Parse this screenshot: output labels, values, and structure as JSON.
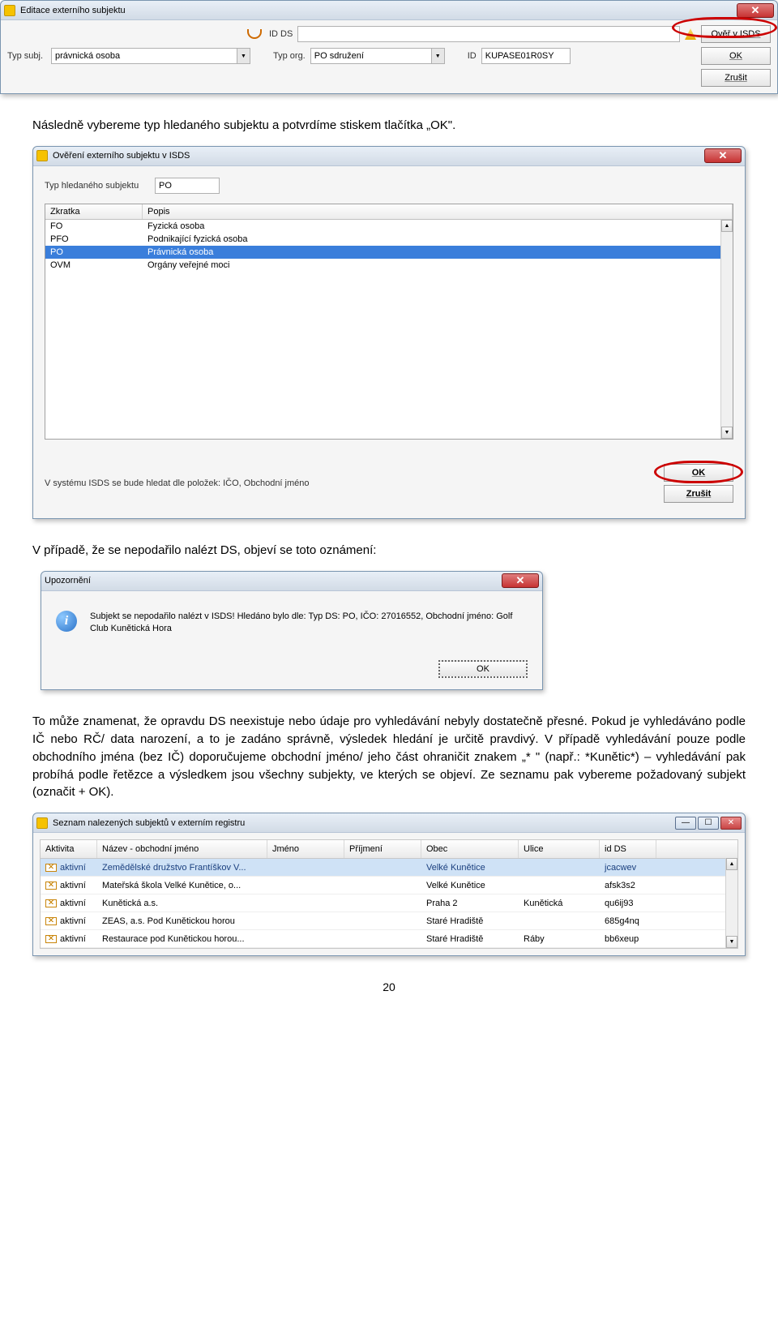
{
  "top_dialog": {
    "title": "Editace externího subjektu",
    "id_ds_label": "ID DS",
    "over_btn": "Ověř v ISDS",
    "typ_subj_label": "Typ subj.",
    "typ_subj_val": "právnická osoba",
    "typ_org_label": "Typ org.",
    "typ_org_val": "PO sdružení",
    "id_label": "ID",
    "id_val": "KUPASE01R0SY",
    "ok_btn": "OK",
    "cancel_btn": "Zrušit"
  },
  "para1": "Následně vybereme typ hledaného subjektu a potvrdíme stiskem tlačítka „OK\".",
  "verify_dialog": {
    "title": "Ověření externího subjektu v ISDS",
    "typ_label": "Typ hledaného subjektu",
    "typ_val": "PO",
    "head_zk": "Zkratka",
    "head_popis": "Popis",
    "rows": [
      {
        "zk": "FO",
        "pop": "Fyzická osoba"
      },
      {
        "zk": "PFO",
        "pop": "Podnikající fyzická osoba"
      },
      {
        "zk": "PO",
        "pop": "Právnická osoba"
      },
      {
        "zk": "OVM",
        "pop": "Orgány veřejné moci"
      }
    ],
    "footer_text": "V systému ISDS se bude hledat dle položek: IČO, Obchodní jméno",
    "ok_btn": "OK",
    "cancel_btn": "Zrušit"
  },
  "para2": "V případě, že se nepodařilo nalézt DS, objeví se toto oznámení:",
  "alert": {
    "title": "Upozornění",
    "body": "Subjekt se nepodařilo nalézt v ISDS! Hledáno bylo dle:  Typ DS: PO, IČO: 27016552, Obchodní jméno: Golf Club Kunětická Hora",
    "ok_btn": "OK"
  },
  "para3": "To může znamenat, že opravdu DS neexistuje nebo údaje pro vyhledávání nebyly dostatečně přesné. Pokud je vyhledáváno podle IČ nebo RČ/ data narození, a to je zadáno správně, výsledek hledání je určitě pravdivý. V případě vyhledávání pouze podle obchodního jména (bez IČ) doporučujeme obchodní jméno/ jeho část ohraničit znakem „* \" (např.: *Kunětic*) – vyhledávání pak probíhá podle řetězce a výsledkem jsou všechny subjekty, ve kterých se objeví. Ze seznamu pak vybereme požadovaný subjekt (označit + OK).",
  "results": {
    "title": "Seznam nalezených subjektů v externím registru",
    "head": {
      "akt": "Aktivita",
      "naz": "Název - obchodní jméno",
      "jm": "Jméno",
      "pr": "Příjmení",
      "ob": "Obec",
      "ul": "Ulice",
      "id": "id DS"
    },
    "rows": [
      {
        "akt": "aktivní",
        "naz": "Zemědělské družstvo Frantíškov V...",
        "jm": "",
        "pr": "",
        "ob": "Velké Kunětice",
        "ul": "",
        "id": "jcacwev"
      },
      {
        "akt": "aktivní",
        "naz": "Mateřská škola Velké Kunětice, o...",
        "jm": "",
        "pr": "",
        "ob": "Velké Kunětice",
        "ul": "",
        "id": "afsk3s2"
      },
      {
        "akt": "aktivní",
        "naz": "Kunětická a.s.",
        "jm": "",
        "pr": "",
        "ob": "Praha 2",
        "ul": "Kunětická",
        "id": "qu6ij93"
      },
      {
        "akt": "aktivní",
        "naz": "ZEAS, a.s. Pod Kunětickou horou",
        "jm": "",
        "pr": "",
        "ob": "Staré Hradiště",
        "ul": "",
        "id": "685g4nq"
      },
      {
        "akt": "aktivní",
        "naz": "Restaurace pod Kunětickou horou...",
        "jm": "",
        "pr": "",
        "ob": "Staré Hradiště",
        "ul": "Ráby",
        "id": "bb6xeup"
      }
    ]
  },
  "page_number": "20"
}
